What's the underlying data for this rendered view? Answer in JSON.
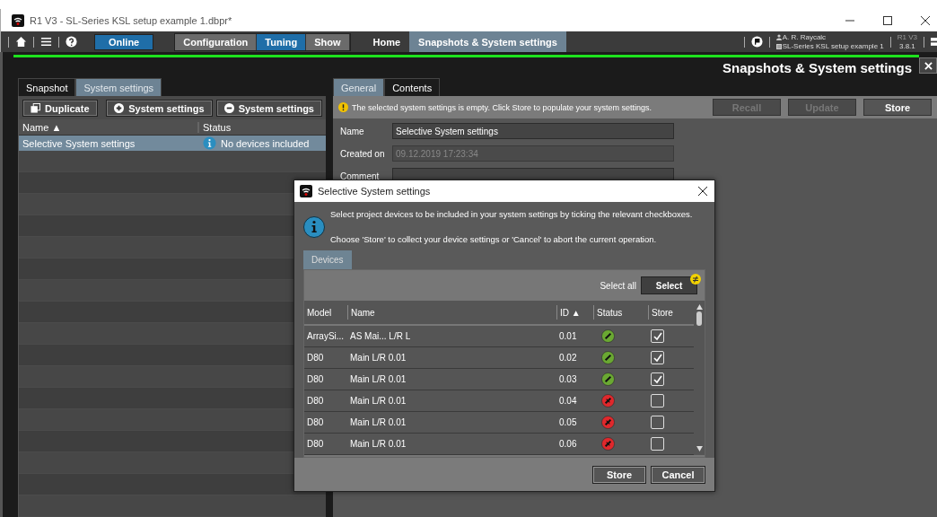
{
  "window": {
    "title": "R1 V3 - SL-Series KSL setup example 1.dbpr*"
  },
  "toolbar": {
    "online": {
      "label": "Online",
      "selected": true
    },
    "modes": [
      {
        "label": "Configuration",
        "selected": false
      },
      {
        "label": "Tuning",
        "selected": true
      },
      {
        "label": "Show",
        "selected": false
      }
    ],
    "nav_tabs": [
      {
        "label": "Home",
        "selected": false
      },
      {
        "label": "Snapshots & System settings",
        "selected": true
      }
    ],
    "user": "A. R. Raycalc",
    "project": "SL-Series KSL setup example 1",
    "app": "R1 V3",
    "version": "3.8.1"
  },
  "page_title": "Snapshots & System settings",
  "left_panel": {
    "tabs": [
      {
        "label": "Snapshot",
        "selected": false
      },
      {
        "label": "System settings",
        "selected": true
      }
    ],
    "buttons": [
      {
        "label": "Duplicate",
        "kind": "duplicate"
      },
      {
        "label": "System settings",
        "kind": "add"
      },
      {
        "label": "System settings",
        "kind": "remove"
      }
    ],
    "columns": [
      "Name ▲",
      "Status"
    ],
    "rows": [
      {
        "name": "Selective System settings",
        "status": "No devices included",
        "selected": true
      }
    ]
  },
  "right_panel": {
    "tabs": [
      {
        "label": "General",
        "selected": true
      },
      {
        "label": "Contents",
        "selected": false
      }
    ],
    "notice": "The selected system settings is empty. Click Store to populate your system settings.",
    "buttons": [
      {
        "label": "Recall",
        "disabled": true
      },
      {
        "label": "Update",
        "disabled": true
      },
      {
        "label": "Store",
        "disabled": false
      }
    ],
    "fields": [
      {
        "label": "Name",
        "value": "Selective System settings",
        "disabled": false
      },
      {
        "label": "Created on",
        "value": "09.12.2019 17:23:34",
        "disabled": true
      },
      {
        "label": "Comment",
        "disabled": false
      }
    ]
  },
  "dialog": {
    "title": "Selective System settings",
    "messages": [
      "Select project devices to be included in your system settings by ticking the relevant checkboxes.",
      "Choose 'Store' to collect your device settings or 'Cancel' to abort the current operation."
    ],
    "tab": {
      "label": "Devices",
      "selected": true
    },
    "select_all_label": "Select all",
    "select_button": "Select",
    "columns": [
      "Model",
      "Name",
      "ID ▲",
      "Status",
      "Store"
    ],
    "rows": [
      {
        "model": "ArraySi...",
        "name": "AS Mai... L/R L",
        "id": "0.01",
        "online": true,
        "checked": true
      },
      {
        "model": "D80",
        "name": "Main L/R 0.01",
        "id": "0.02",
        "online": true,
        "checked": true
      },
      {
        "model": "D80",
        "name": "Main L/R 0.01",
        "id": "0.03",
        "online": true,
        "checked": true
      },
      {
        "model": "D80",
        "name": "Main L/R 0.01",
        "id": "0.04",
        "online": false,
        "checked": false
      },
      {
        "model": "D80",
        "name": "Main L/R 0.01",
        "id": "0.05",
        "online": false,
        "checked": false
      },
      {
        "model": "D80",
        "name": "Main L/R 0.01",
        "id": "0.06",
        "online": false,
        "checked": false
      }
    ],
    "buttons": [
      "Store",
      "Cancel"
    ]
  }
}
